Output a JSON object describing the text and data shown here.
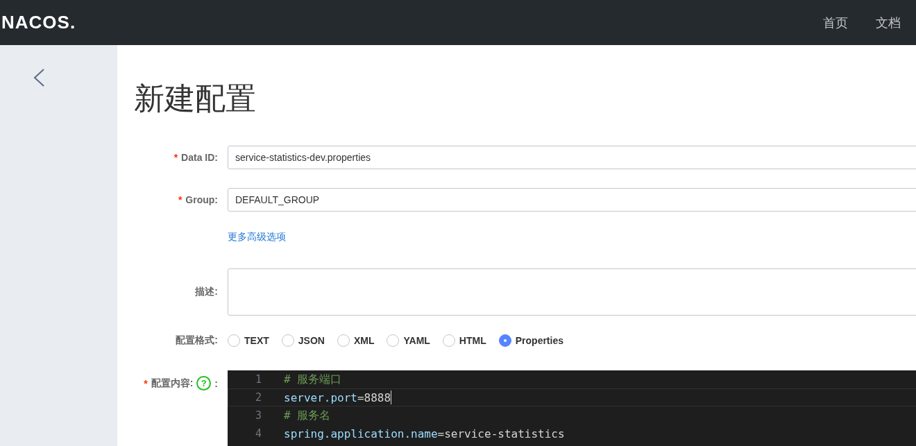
{
  "header": {
    "logo": "NACOS.",
    "nav": [
      {
        "label": "首页"
      },
      {
        "label": "文档"
      }
    ]
  },
  "page_title": "新建配置",
  "form": {
    "data_id": {
      "label": "Data ID:",
      "required_mark": "*",
      "value": "service-statistics-dev.properties"
    },
    "group": {
      "label": "Group:",
      "required_mark": "*",
      "value": "DEFAULT_GROUP"
    },
    "advanced_link": "更多高级选项",
    "description": {
      "label": "描述:"
    },
    "format": {
      "label": "配置格式:",
      "options": [
        {
          "label": "TEXT",
          "selected": false
        },
        {
          "label": "JSON",
          "selected": false
        },
        {
          "label": "XML",
          "selected": false
        },
        {
          "label": "YAML",
          "selected": false
        },
        {
          "label": "HTML",
          "selected": false
        },
        {
          "label": "Properties",
          "selected": true
        }
      ]
    },
    "content": {
      "label": "配置内容:",
      "required_mark": "*",
      "help": "?",
      "colon": ":",
      "lines": [
        {
          "number": "1",
          "current": false,
          "tokens": [
            {
              "kind": "comment",
              "text": "# 服务端口"
            }
          ]
        },
        {
          "number": "2",
          "current": true,
          "tokens": [
            {
              "kind": "key",
              "text": "server.port"
            },
            {
              "kind": "value",
              "text": "=8888"
            }
          ]
        },
        {
          "number": "3",
          "current": false,
          "tokens": [
            {
              "kind": "comment",
              "text": "# 服务名"
            }
          ]
        },
        {
          "number": "4",
          "current": false,
          "tokens": [
            {
              "kind": "key",
              "text": "spring.application.name"
            },
            {
              "kind": "value",
              "text": "=service-statistics"
            }
          ]
        }
      ]
    }
  }
}
